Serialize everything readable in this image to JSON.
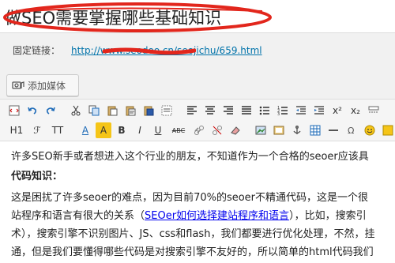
{
  "post": {
    "title": "做SEO需要掌握哪些基础知识"
  },
  "permalink": {
    "label": "固定链接：",
    "url": "http://www.seodoo.cn/seojichu/659.html"
  },
  "media_button": {
    "label": "添加媒体",
    "icon": "camera-music-icon"
  },
  "toolbar": {
    "heading_label": "H1",
    "font_label": "ℱ",
    "size_label": "TT",
    "text_color_label": "A",
    "highlight_label": "A",
    "bold": "B",
    "italic": "I",
    "underline": "U",
    "abc": "ABC",
    "superscript": "x²",
    "subscript": "x₂",
    "highlight_color": "#f5c518"
  },
  "content": {
    "para1": "许多SEO新手或者想进入这个行业的朋友，不知道作为一个合格的seoer应该具",
    "heading": "代码知识：",
    "para2_line1": "这是困扰了许多seoer的难点，因为目前70%的seoer不精通代码，这是一个很",
    "para2_line2_pre": "站程序和语言有很大的关系（",
    "para2_link": "SEOer如何选择建站程序和语言",
    "para2_line2_post": "），比如，搜索引",
    "para2_line3": "术），搜索引擎不识别图片、JS、css和flash，我们都要进行优化处理，不然，挂",
    "para2_line4": "通，但是我们要懂得哪些代码是对搜索引擎不友好的，所以简单的html代码我们"
  }
}
